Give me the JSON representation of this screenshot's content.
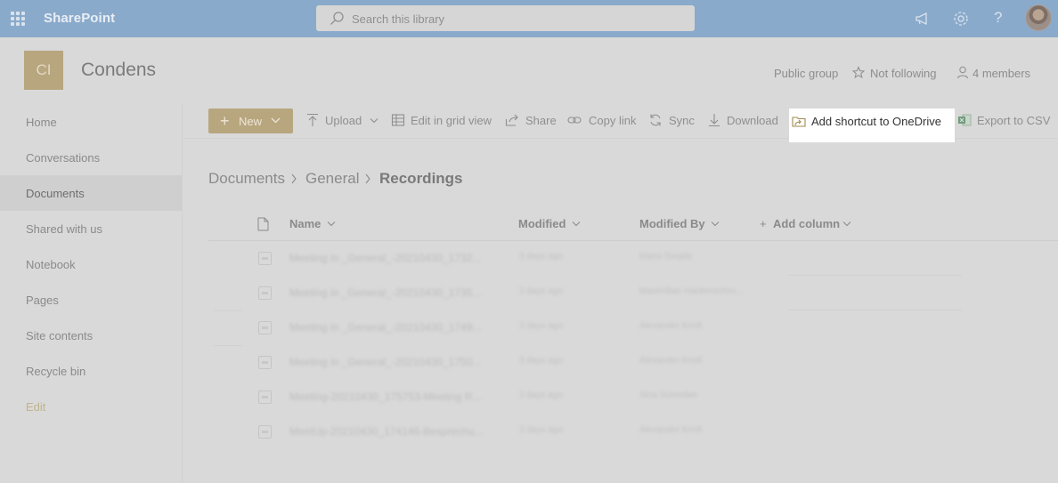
{
  "suite": {
    "brand": "SharePoint",
    "search_placeholder": "Search this library"
  },
  "site": {
    "logo_initials": "CI",
    "title": "Condens",
    "privacy": "Public group",
    "follow": "Not following",
    "members": "4 members"
  },
  "nav": {
    "items": [
      "Home",
      "Conversations",
      "Documents",
      "Shared with us",
      "Notebook",
      "Pages",
      "Site contents",
      "Recycle bin"
    ],
    "edit": "Edit"
  },
  "commands": {
    "new": "New",
    "upload": "Upload",
    "grid": "Edit in grid view",
    "share": "Share",
    "copy_link": "Copy link",
    "sync": "Sync",
    "download": "Download",
    "shortcut": "Add shortcut to OneDrive",
    "export": "Export to CSV"
  },
  "breadcrumb": [
    "Documents",
    "General",
    "Recordings"
  ],
  "columns": {
    "name": "Name",
    "modified": "Modified",
    "modified_by": "Modified By",
    "add_column": "Add column"
  },
  "rows": [
    {
      "name": "Meeting in _General_-20210430_1732...",
      "modified": "3 days ago",
      "by": "Manú Svejda"
    },
    {
      "name": "Meeting in _General_-20210430_1735...",
      "modified": "3 days ago",
      "by": "Maximilian Hackenschm..."
    },
    {
      "name": "Meeting in _General_-20210430_1749...",
      "modified": "3 days ago",
      "by": "Alexander Knoll"
    },
    {
      "name": "Meeting in _General_-20210430_1750...",
      "modified": "3 days ago",
      "by": "Alexander Knoll"
    },
    {
      "name": "Meeting-20210430_175753-Meeting R...",
      "modified": "3 days ago",
      "by": "Sina Schreiber"
    },
    {
      "name": "MeetUp-20210430_174146-Besprechu...",
      "modified": "3 days ago",
      "by": "Alexander Knoll"
    }
  ],
  "colors": {
    "suite_bar": "#8aaacb",
    "accent": "#b8a67f",
    "overlay": "#d9d9d9",
    "highlight": "#ffffff"
  }
}
